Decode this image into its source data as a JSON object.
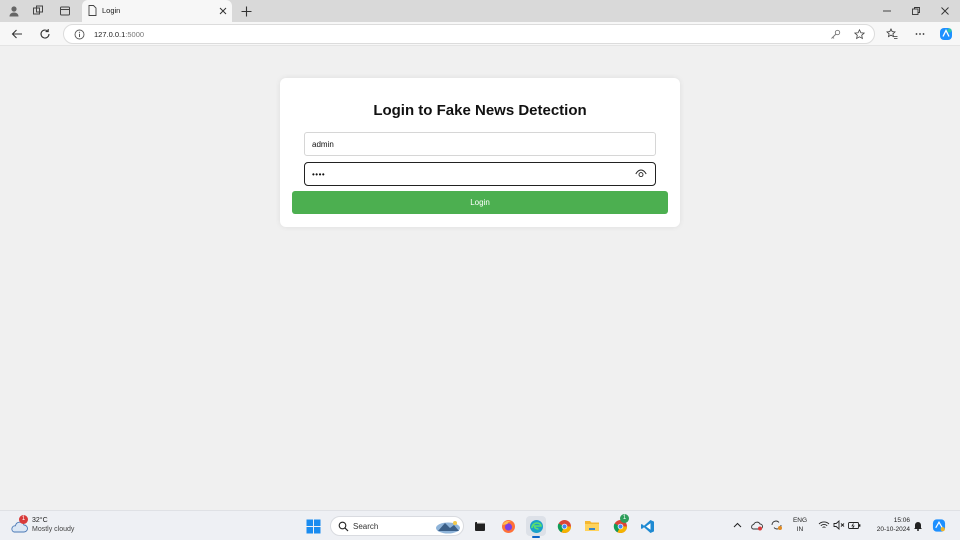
{
  "browser": {
    "tab": {
      "title": "Login"
    },
    "address": {
      "host": "127.0.0.1",
      "port": ":5000"
    }
  },
  "page": {
    "heading": "Login to Fake News Detection",
    "username_value": "admin",
    "password_value": "••••",
    "login_label": "Login"
  },
  "taskbar": {
    "weather": {
      "temp": "32°C",
      "condition": "Mostly cloudy",
      "badge": "1"
    },
    "search_label": "Search",
    "lang_line1": "ENG",
    "lang_line2": "IN",
    "time": "15:06",
    "date": "20-10-2024",
    "chrome_badge": "1"
  },
  "colors": {
    "login_button": "#4caf50",
    "page_background": "#f0f0f0",
    "card_background": "#ffffff"
  },
  "icons": [
    "profile-icon",
    "workspaces-icon",
    "tab-actions-icon",
    "page-icon",
    "close-icon",
    "new-tab-icon",
    "minimize-icon",
    "restore-icon",
    "window-close-icon",
    "back-icon",
    "refresh-icon",
    "info-icon",
    "password-key-icon",
    "favorite-star-icon",
    "favorites-icon",
    "more-icon",
    "copilot-icon",
    "eye-icon",
    "weather-icon",
    "windows-start-icon",
    "search-icon",
    "task-view-icon",
    "firefox-icon",
    "edge-icon",
    "chrome-icon",
    "file-explorer-icon",
    "vscode-icon",
    "chevron-up-icon",
    "wifi-icon",
    "volume-icon",
    "battery-icon",
    "notification-bell-icon"
  ]
}
